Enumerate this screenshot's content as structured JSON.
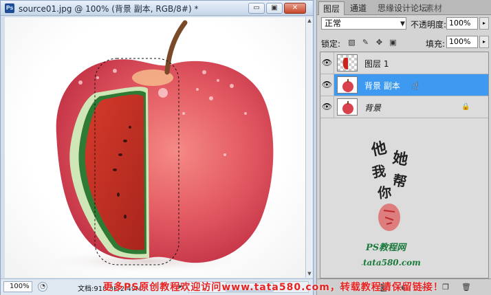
{
  "document": {
    "app_icon": "photoshop-icon",
    "title": "source01.jpg @ 100% (背景 副本, RGB/8#) *",
    "window_buttons": {
      "minimize": "▭",
      "maximize": "▣",
      "close": "✕"
    },
    "zoom": "100%",
    "doc_info": "文档:918.8K/2.49M",
    "status_arrow": "▶"
  },
  "layers_panel": {
    "tabs": [
      "图层",
      "通道",
      "思缘设计论坛",
      "素材"
    ],
    "blend_mode": "正常",
    "opacity_label": "不透明度:",
    "opacity": "100%",
    "lock_label": "锁定:",
    "fill_label": "填充:",
    "fill": "100%",
    "layers": [
      {
        "name": "图层 1",
        "visible": true,
        "selected": false
      },
      {
        "name": "背景 副本",
        "visible": true,
        "selected": true
      },
      {
        "name": "背景",
        "visible": true,
        "selected": false,
        "locked": true
      }
    ],
    "arrow": "▸"
  },
  "watermark": {
    "calligraphy": [
      "他",
      "她",
      "我",
      "帮",
      "你"
    ],
    "site_cn": "PS教程网",
    "site_url": "www.tata580.com",
    "banner": "更多PS原创教程欢迎访问www.tata580.com，转载教程请保留链接！"
  },
  "colors": {
    "selection_blue": "#3d9af0",
    "watermark_red": "#e52323",
    "calligraphy_green": "#1a7a3c"
  }
}
